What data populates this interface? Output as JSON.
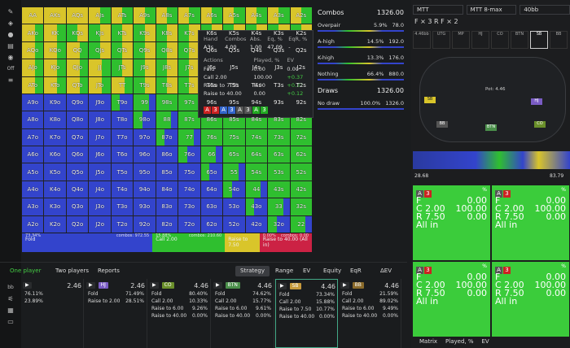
{
  "left_sidebar": {
    "icons": [
      "pin-icon",
      "shield-icon",
      "lightbulb-icon",
      "layers-icon",
      "eye-icon",
      "off-toggle-icon",
      "list-icon"
    ],
    "off_label": "Off"
  },
  "matrix": {
    "rows": [
      [
        "AA",
        "AKs",
        "AQs",
        "AJs",
        "ATs",
        "A9s",
        "A8s",
        "A7s",
        "A6s",
        "A5s",
        "A4s",
        "A3s",
        "A2s"
      ],
      [
        "AKo",
        "KK",
        "KQs",
        "KJs",
        "KTs",
        "K9s",
        "K8s",
        "K7s",
        "K6s",
        "K5s",
        "K4s",
        "K3s",
        "K2s"
      ],
      [
        "AQo",
        "KQo",
        "QQ",
        "QJs",
        "QTs",
        "Q9s",
        "Q8s",
        "Q7s",
        "Q6s",
        "Q5s",
        "Q4s",
        "Q3s",
        "Q2s"
      ],
      [
        "AJo",
        "KJo",
        "QJo",
        "JJ",
        "JTs",
        "J9s",
        "J8s",
        "J7s",
        "J6s",
        "J5s",
        "J4s",
        "J3s",
        "J2s"
      ],
      [
        "ATo",
        "KTo",
        "QTo",
        "JTo",
        "TT",
        "T9s",
        "T8s",
        "T7s",
        "T6s",
        "T5s",
        "T4s",
        "T3s",
        "T2s"
      ],
      [
        "A9o",
        "K9o",
        "Q9o",
        "J9o",
        "T9o",
        "99",
        "98s",
        "97s",
        "96s",
        "95s",
        "94s",
        "93s",
        "92s"
      ],
      [
        "A8o",
        "K8o",
        "Q8o",
        "J8o",
        "T8o",
        "98o",
        "88",
        "87s",
        "86s",
        "85s",
        "84s",
        "83s",
        "82s"
      ],
      [
        "A7o",
        "K7o",
        "Q7o",
        "J7o",
        "T7o",
        "97o",
        "87o",
        "77",
        "76s",
        "75s",
        "74s",
        "73s",
        "72s"
      ],
      [
        "A6o",
        "K6o",
        "Q6o",
        "J6o",
        "T6o",
        "96o",
        "86o",
        "76o",
        "66",
        "65s",
        "64s",
        "63s",
        "62s"
      ],
      [
        "A5o",
        "K5o",
        "Q5o",
        "J5o",
        "T5o",
        "95o",
        "85o",
        "75o",
        "65o",
        "55",
        "54s",
        "53s",
        "52s"
      ],
      [
        "A4o",
        "K4o",
        "Q4o",
        "J4o",
        "T4o",
        "94o",
        "84o",
        "74o",
        "64o",
        "54o",
        "44",
        "43s",
        "42s"
      ],
      [
        "A3o",
        "K3o",
        "Q3o",
        "J3o",
        "T3o",
        "93o",
        "83o",
        "73o",
        "63o",
        "53o",
        "43o",
        "33",
        "32s"
      ],
      [
        "A2o",
        "K2o",
        "Q2o",
        "J2o",
        "T2o",
        "92o",
        "82o",
        "72o",
        "62o",
        "52o",
        "42o",
        "32o",
        "22"
      ]
    ],
    "summary": [
      {
        "label": "Fold",
        "pct": "73.34%",
        "combos": "combos: 972.55",
        "color": "#3344cc"
      },
      {
        "label": "Call 2.00",
        "pct": "15.88%",
        "combos": "combos: 210.60",
        "color": "#2fbf2f"
      },
      {
        "label": "Raise to 7.50",
        "pct": "",
        "combos": "",
        "color": "#d9c52a"
      },
      {
        "label": "Raise to 40.00 (All in)",
        "pct": "0.00%",
        "combos": "combos: 0.00",
        "color": "#cc2244"
      }
    ]
  },
  "popup": {
    "header": [
      "Hand",
      "Combos",
      "Abs.",
      "Eq, %",
      "EqR, %"
    ],
    "hand": [
      "A3s",
      "4.00",
      "1.00",
      "47.09",
      "-"
    ],
    "actions_header": [
      "Actions",
      "Played, %",
      "EV"
    ],
    "actions": [
      {
        "name": "Fold",
        "played": "0.00",
        "ev": "0.00",
        "color": "#ddd"
      },
      {
        "name": "Call 2.00",
        "played": "100.00",
        "ev": "+0.37",
        "color": "#4c4"
      },
      {
        "name": "Raise to 7.50",
        "played": "0.00",
        "ev": "+0.32",
        "color": "#4c4"
      },
      {
        "name": "Raise to 40.00",
        "played": "0.00",
        "ev": "+0.12",
        "color": "#4c4"
      }
    ],
    "board": [
      "A",
      "3",
      "A",
      "3",
      "A",
      "3",
      "A",
      "3"
    ]
  },
  "stats": {
    "combos_title": "Combos",
    "combos_total": "1326.00",
    "rows": [
      {
        "label": "Overpair",
        "pct": "5.9%",
        "val": "78.0"
      },
      {
        "label": "A-high",
        "pct": "14.5%",
        "val": "192.0"
      },
      {
        "label": "K-high",
        "pct": "13.3%",
        "val": "176.0"
      },
      {
        "label": "Nothing",
        "pct": "66.4%",
        "val": "880.0"
      }
    ],
    "draws_title": "Draws",
    "draws_total": "1326.00",
    "draw_rows": [
      {
        "label": "No draw",
        "pct": "100.0%",
        "val": "1326.0"
      }
    ]
  },
  "bottom_tabs": {
    "left": [
      "One player",
      "Two players",
      "Reports"
    ],
    "right": [
      "Strategy",
      "Range",
      "EV",
      "Equity",
      "EqR",
      "ΔEV"
    ]
  },
  "panels": [
    {
      "pos": "",
      "ev": "2.46",
      "rows": [
        [
          "76.11%",
          ""
        ],
        [
          "23.89%",
          ""
        ]
      ],
      "tag_color": "#555"
    },
    {
      "pos": "HJ",
      "ev": "2.46",
      "rows": [
        [
          "Fold",
          "71.49%"
        ],
        [
          "Raise to 2.00",
          "28.51%"
        ]
      ],
      "tag_color": "#7a5cc4"
    },
    {
      "pos": "CO",
      "ev": "4.46",
      "rows": [
        [
          "Fold",
          "80.40%"
        ],
        [
          "Call 2.00",
          "10.33%"
        ],
        [
          "Raise to 6.00",
          "9.26%"
        ],
        [
          "Raise to 40.00",
          "0.00%"
        ]
      ],
      "tag_color": "#6a8f2a"
    },
    {
      "pos": "BTN",
      "ev": "4.46",
      "rows": [
        [
          "Fold",
          "74.62%"
        ],
        [
          "Call 2.00",
          "15.77%"
        ],
        [
          "Raise to 6.00",
          "9.61%"
        ],
        [
          "Raise to 40.00",
          "0.00%"
        ]
      ],
      "tag_color": "#4a8f4a"
    },
    {
      "pos": "SB",
      "ev": "4.46",
      "rows": [
        [
          "Fold",
          "73.34%"
        ],
        [
          "Call 2.00",
          "15.88%"
        ],
        [
          "Raise to 7.50",
          "10.77%"
        ],
        [
          "Raise to 40.00",
          "0.00%"
        ]
      ],
      "tag_color": "#c79a3c"
    },
    {
      "pos": "BB",
      "ev": "4.46",
      "rows": [
        [
          "Fold",
          "21.59%"
        ],
        [
          "Call 2.00",
          "89.02%"
        ],
        [
          "Raise to 6.00",
          "9.49%"
        ],
        [
          "Raise to 40.00",
          "0.00%"
        ]
      ],
      "tag_color": "#8a6a2a"
    }
  ],
  "right_panel": {
    "dropdowns": [
      "MTT",
      "MTT 8-max",
      "40bb"
    ],
    "flop": "F × 3   R   F × 2",
    "seats": [
      "4.46bb",
      "UTG",
      "MP",
      "HJ",
      "CO",
      "BTN",
      "SB",
      "BB"
    ],
    "pot": "Pot: 4.46",
    "timeline_left": "28.68",
    "timeline_right": "83.79",
    "cells": [
      {
        "cards": [
          "A",
          "3"
        ],
        "rows": [
          [
            "F",
            "0.00"
          ],
          [
            "C 2.00",
            "100.00"
          ],
          [
            "R 7.50",
            "0.00"
          ],
          [
            "All in",
            ""
          ]
        ]
      },
      {
        "cards": [
          "A",
          "3"
        ],
        "rows": [
          [
            "F",
            "0.00"
          ],
          [
            "C 2.00",
            "100.00"
          ],
          [
            "R 7.50",
            "0.00"
          ],
          [
            "All in",
            ""
          ]
        ]
      },
      {
        "cards": [
          "A",
          "3"
        ],
        "rows": [
          [
            "F",
            "0.00"
          ],
          [
            "C 2.00",
            "100.00"
          ],
          [
            "R 7.50",
            "0.00"
          ],
          [
            "All in",
            ""
          ]
        ]
      },
      {
        "cards": [
          "A",
          "3"
        ],
        "rows": [
          [
            "F",
            "0.00"
          ],
          [
            "C 2.00",
            "100.00"
          ],
          [
            "R 7.50",
            "0.00"
          ],
          [
            "All in",
            ""
          ]
        ]
      }
    ],
    "bottom_tabs": [
      "Matrix",
      "Played, %",
      "EV"
    ]
  }
}
